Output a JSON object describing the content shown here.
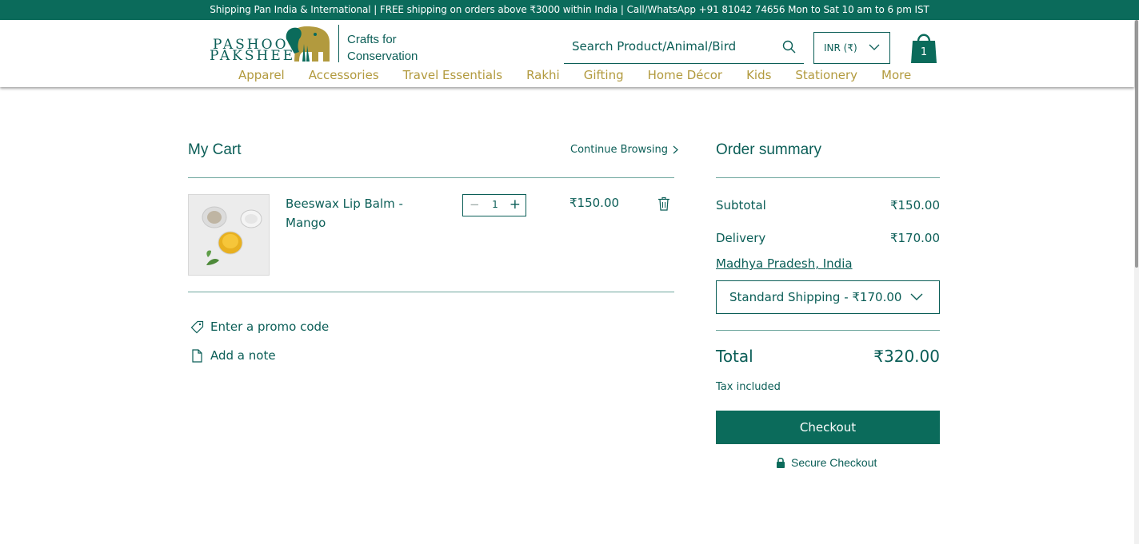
{
  "colors": {
    "brand_green": "#0b6b5b",
    "text_green": "#0b5e57",
    "nav_gold": "#b29a3e"
  },
  "topbar": {
    "text": "Shipping Pan India & International | FREE shipping on orders above ₹3000 within India | Call/WhatsApp +91 81042 74656 Mon to Sat 10 am to 6 pm IST"
  },
  "header": {
    "logo": {
      "line1": "PASHOO",
      "line2": "PAKSHEE",
      "tagline1": "Crafts for",
      "tagline2": "Conservation",
      "icon": "elephant-logo-icon"
    },
    "search": {
      "placeholder": "Search Product/Animal/Bird",
      "icon": "search-icon"
    },
    "currency": {
      "selected": "INR (₹)",
      "icon": "chevron-down-icon"
    },
    "cart": {
      "count": "1",
      "icon": "shopping-bag-icon"
    },
    "nav": [
      {
        "label": "Apparel"
      },
      {
        "label": "Accessories"
      },
      {
        "label": "Travel Essentials"
      },
      {
        "label": "Rakhi"
      },
      {
        "label": "Gifting"
      },
      {
        "label": "Home Décor"
      },
      {
        "label": "Kids"
      },
      {
        "label": "Stationery"
      },
      {
        "label": "More"
      }
    ]
  },
  "cart": {
    "title": "My Cart",
    "continue_label": "Continue Browsing",
    "items": [
      {
        "name": "Beeswax Lip Balm - Mango",
        "quantity": "1",
        "price": "₹150.00"
      }
    ],
    "promo_label": "Enter a promo code",
    "note_label": "Add a note"
  },
  "summary": {
    "title": "Order summary",
    "subtotal_label": "Subtotal",
    "subtotal_value": "₹150.00",
    "delivery_label": "Delivery",
    "delivery_value": "₹170.00",
    "location": "Madhya Pradesh, India",
    "shipping_option": "Standard Shipping - ₹170.00",
    "total_label": "Total",
    "total_value": "₹320.00",
    "tax_note": "Tax included",
    "checkout_label": "Checkout",
    "secure_label": "Secure Checkout"
  }
}
